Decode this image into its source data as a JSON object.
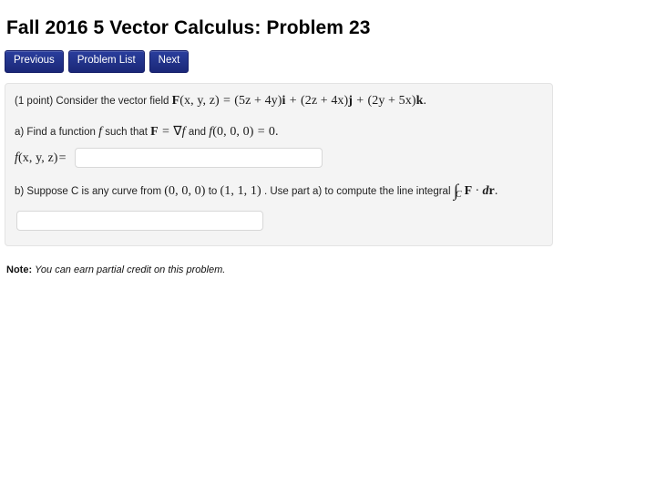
{
  "page_title": "Fall 2016 5 Vector Calculus: Problem 23",
  "nav": {
    "previous_label": "Previous",
    "problem_list_label": "Problem List",
    "next_label": "Next",
    "button_color": "#23348c",
    "button_text_color": "#ffffff"
  },
  "problem": {
    "points_text": "(1 point)",
    "intro_text": "Consider the vector field",
    "field_lhs": "F",
    "field_args": "(x, y, z)",
    "equals": "=",
    "term_i_coeff": "(5z + 4y)",
    "unit_i": "i",
    "plus_1": "+",
    "term_j_coeff": "(2z + 4x)",
    "unit_j": "j",
    "plus_2": "+",
    "term_k_coeff": "(2y + 5x)",
    "unit_k": "k",
    "period": ".",
    "part_a": {
      "lead": "a) Find a function",
      "fn": "f",
      "mid": "such that",
      "field": "F",
      "eq": "=",
      "grad": "∇",
      "grad_fn": "f",
      "and_text": "and",
      "condition_fn": "f",
      "condition_args": "(0, 0, 0)",
      "condition_eq": "=",
      "condition_value": "0",
      "condition_period": ".",
      "answer_label_fn": "f",
      "answer_label_args": "(x, y, z)",
      "answer_label_eq": "=",
      "answer_value": "",
      "answer_placeholder": ""
    },
    "part_b": {
      "lead": "b) Suppose C is any curve from",
      "point_from": "(0, 0, 0)",
      "to_text": "to",
      "point_to": "(1, 1, 1)",
      "tail": ". Use part a) to compute the line integral",
      "integral_symbol": "∫",
      "integral_subscript": "C",
      "integral_field": "F",
      "integral_dot": "·",
      "integral_d": "d",
      "integral_r": "r",
      "integral_period": ".",
      "answer_value": "",
      "answer_placeholder": ""
    }
  },
  "note": {
    "label": "Note:",
    "text": "You can earn partial credit on this problem."
  }
}
